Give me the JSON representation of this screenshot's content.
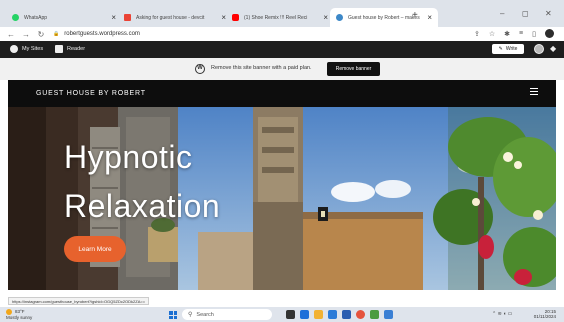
{
  "browser": {
    "tabs": [
      {
        "label": "WhatsApp",
        "favicon_color": "#25d366",
        "active": false
      },
      {
        "label": "Asking for guest house - devcit",
        "favicon_color": "#ea4335",
        "active": false
      },
      {
        "label": "(1) Shoe Remix !!! Reel Reci",
        "favicon_color": "#ff0000",
        "active": false
      },
      {
        "label": "Guest house by Robert – makes",
        "favicon_color": "#3d88c8",
        "active": true
      }
    ],
    "url": "robertguests.wordpress.com"
  },
  "wp_admin_bar": {
    "my_sites": "My Sites",
    "reader": "Reader",
    "write": "Write"
  },
  "promo_banner": {
    "message": "Remove this site banner with a paid plan.",
    "button": "Remove banner"
  },
  "site": {
    "title": "GUEST HOUSE BY ROBERT",
    "hero": {
      "line1": "Hypnotic",
      "line2": "Relaxation",
      "cta": "Learn More",
      "cta_color": "#e7622d"
    }
  },
  "status_url": "https://instagram.com/guesthouse_byrobert?igshid=OGQ5ZDc2ODk2ZA==",
  "taskbar": {
    "weather_temp": "83°F",
    "weather_desc": "Mostly sunny",
    "search": "Search",
    "time": "20:15",
    "date": "01/11/2024"
  }
}
